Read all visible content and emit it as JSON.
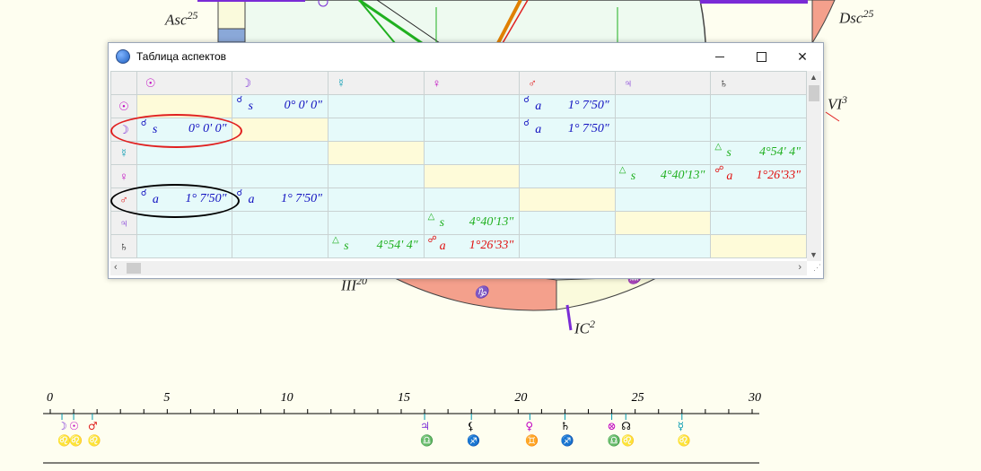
{
  "window": {
    "title": "Таблица аспектов"
  },
  "chart_labels": {
    "asc": "Asc",
    "asc_deg": "25",
    "dsc": "Dsc",
    "dsc_deg": "25",
    "vi": "VI",
    "vi_deg": "3",
    "iii": "III",
    "iii_deg": "20",
    "ic": "IC",
    "ic_deg": "2",
    "sign_capricorn": "♑",
    "sign_aquarius": "♒"
  },
  "columns": [
    {
      "glyph": "☉",
      "color": "#c000c0"
    },
    {
      "glyph": "☽",
      "color": "#7a2bd6"
    },
    {
      "glyph": "☿",
      "color": "#0099b0"
    },
    {
      "glyph": "♀",
      "color": "#c000c0"
    },
    {
      "glyph": "♂",
      "color": "#e02020"
    },
    {
      "glyph": "♃",
      "color": "#7a2bd6"
    },
    {
      "glyph": "♄",
      "color": "#000000"
    }
  ],
  "rows": [
    {
      "glyph": "☉",
      "color": "#c000c0",
      "cells": [
        null,
        {
          "sym": "☌",
          "type": "s",
          "value": "0° 0' 0\"",
          "color": "#1010c0"
        },
        null,
        null,
        {
          "sym": "☌",
          "type": "a",
          "value": "1° 7'50\"",
          "color": "#1010c0"
        },
        null,
        null
      ]
    },
    {
      "glyph": "☽",
      "color": "#7a2bd6",
      "cells": [
        {
          "sym": "☌",
          "type": "s",
          "value": "0° 0' 0\"",
          "color": "#1010c0"
        },
        null,
        null,
        null,
        {
          "sym": "☌",
          "type": "a",
          "value": "1° 7'50\"",
          "color": "#1010c0"
        },
        null,
        null
      ]
    },
    {
      "glyph": "☿",
      "color": "#0099b0",
      "cells": [
        null,
        null,
        null,
        null,
        null,
        null,
        {
          "sym": "△",
          "type": "s",
          "value": "4°54' 4\"",
          "color": "#20b020"
        }
      ]
    },
    {
      "glyph": "♀",
      "color": "#c000c0",
      "cells": [
        null,
        null,
        null,
        null,
        null,
        {
          "sym": "△",
          "type": "s",
          "value": "4°40'13\"",
          "color": "#20b020"
        },
        {
          "sym": "☍",
          "type": "a",
          "value": "1°26'33\"",
          "color": "#e01010"
        }
      ]
    },
    {
      "glyph": "♂",
      "color": "#e02020",
      "cells": [
        {
          "sym": "☌",
          "type": "a",
          "value": "1° 7'50\"",
          "color": "#1010c0"
        },
        {
          "sym": "☌",
          "type": "a",
          "value": "1° 7'50\"",
          "color": "#1010c0"
        },
        null,
        null,
        null,
        null,
        null
      ]
    },
    {
      "glyph": "♃",
      "color": "#7a2bd6",
      "cells": [
        null,
        null,
        null,
        {
          "sym": "△",
          "type": "s",
          "value": "4°40'13\"",
          "color": "#20b020"
        },
        null,
        null,
        null
      ]
    },
    {
      "glyph": "♄",
      "color": "#000000",
      "cells": [
        null,
        null,
        {
          "sym": "△",
          "type": "s",
          "value": "4°54' 4\"",
          "color": "#20b020"
        },
        {
          "sym": "☍",
          "type": "a",
          "value": "1°26'33\"",
          "color": "#e01010"
        },
        null,
        null,
        null
      ]
    }
  ],
  "scale": {
    "ticks": [
      "0",
      "5",
      "10",
      "15",
      "20",
      "25",
      "30"
    ],
    "planets": [
      {
        "deg": 0.5,
        "glyph": "☽",
        "sign": "♌",
        "color": "#7a2bd6"
      },
      {
        "deg": 1.0,
        "glyph": "☉",
        "sign": "♌",
        "color": "#c000c0"
      },
      {
        "deg": 1.8,
        "glyph": "♂",
        "sign": "♌",
        "color": "#e02020"
      },
      {
        "deg": 16.0,
        "glyph": "♃",
        "sign": "♎",
        "color": "#7a2bd6"
      },
      {
        "deg": 18.0,
        "glyph": "⚸",
        "sign": "♐",
        "color": "#000000"
      },
      {
        "deg": 20.5,
        "glyph": "♀",
        "sign": "♊",
        "color": "#c000c0"
      },
      {
        "deg": 22.0,
        "glyph": "♄",
        "sign": "♐",
        "color": "#000000"
      },
      {
        "deg": 24.0,
        "glyph": "⊗",
        "sign": "♎",
        "color": "#c000c0"
      },
      {
        "deg": 24.6,
        "glyph": "☊",
        "sign": "♌",
        "color": "#000000"
      },
      {
        "deg": 27.0,
        "glyph": "☿",
        "sign": "♌",
        "color": "#0099b0"
      }
    ]
  }
}
